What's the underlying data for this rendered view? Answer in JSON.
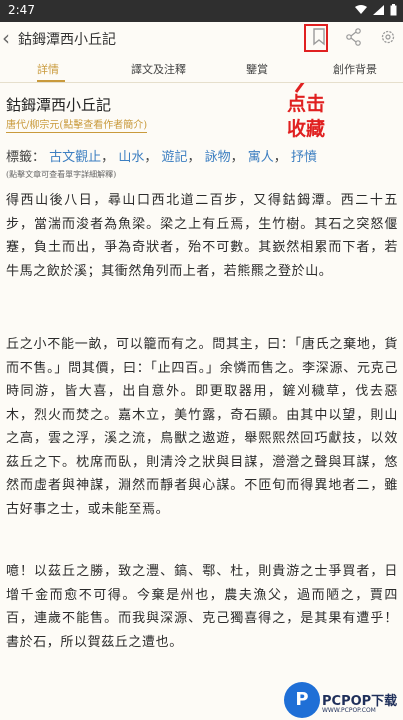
{
  "statusbar": {
    "time": "2:47"
  },
  "toolbar": {
    "title": "鈷鉧潭西小丘記",
    "bookmark_icon": "bookmark-icon",
    "share_icon": "share-icon",
    "settings_icon": "gear-icon"
  },
  "tabs": [
    {
      "label": "詳情",
      "active": true
    },
    {
      "label": "譯文及注釋",
      "active": false
    },
    {
      "label": "鑒賞",
      "active": false
    },
    {
      "label": "創作背景",
      "active": false
    }
  ],
  "callout": {
    "line1": "点击",
    "line2": "收藏",
    "color": "#e02020"
  },
  "poem": {
    "title": "鈷鉧潭西小丘記",
    "author": "唐代/柳宗元(點擊查看作者簡介)",
    "tags_label": "標籤：",
    "tags": [
      "古文觀止",
      "山水",
      "遊記",
      "詠物",
      "寓人",
      "抒憤"
    ],
    "note": "(點擊文章可查看單字詳細解釋)",
    "paragraphs": [
      "得西山後八日，尋山口西北道二百步，又得鈷鉧潭。西二十五步，當湍而浚者為魚梁。梁之上有丘焉，生竹樹。其石之突怒偃蹇，負土而出，爭為奇狀者，殆不可數。其嶔然相累而下者，若牛馬之飲於溪；其衝然角列而上者，若熊羆之登於山。",
      "丘之小不能一畝，可以籠而有之。問其主，曰：「唐氏之棄地，貨而不售。」問其價，曰：「止四百。」余憐而售之。李深源、元克己時同游，皆大喜，出自意外。即更取器用，鏟刈穢草，伐去惡木，烈火而焚之。嘉木立，美竹露，奇石顯。由其中以望，則山之高，雲之浮，溪之流，鳥獸之遨遊，舉熙熙然回巧獻技，以效茲丘之下。枕席而臥，則清泠之狀與目謀，瀯瀯之聲與耳謀，悠然而虛者與神謀，淵然而靜者與心謀。不匝旬而得異地者二，雖古好事之士，或未能至焉。",
      "噫！以茲丘之勝，致之灃、鎬、鄠、杜，則貴游之士爭買者，日增千金而愈不可得。今棄是州也，農夫漁父，過而陋之，賈四百，連歲不能售。而我與深源、克己獨喜得之，是其果有遭乎！書於石，所以賀茲丘之遭也。"
    ]
  },
  "colors": {
    "accent": "#c99a3c",
    "tag": "#3d7fc1",
    "background": "#fdfbf6"
  },
  "watermark": {
    "logo": "P",
    "text": "PCPOP下载",
    "sub": "WWW.PCPOP.COM"
  }
}
